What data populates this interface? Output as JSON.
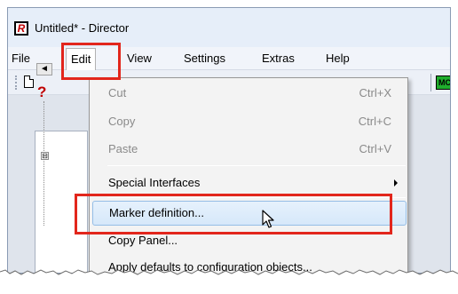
{
  "window": {
    "title": "Untitled* - Director",
    "logo_letter": "R"
  },
  "menubar": {
    "items": [
      {
        "label": "File"
      },
      {
        "label": "Edit"
      },
      {
        "label": "View"
      },
      {
        "label": "Settings"
      },
      {
        "label": "Extras"
      },
      {
        "label": "Help"
      }
    ]
  },
  "toolbar": {
    "mc_label": "MC"
  },
  "edit_menu": {
    "items": [
      {
        "label": "Cut",
        "shortcut": "Ctrl+X",
        "disabled": true
      },
      {
        "label": "Copy",
        "shortcut": "Ctrl+C",
        "disabled": true
      },
      {
        "label": "Paste",
        "shortcut": "Ctrl+V",
        "disabled": true
      },
      {
        "label": "Special Interfaces",
        "has_submenu": true
      },
      {
        "label": "Marker definition...",
        "highlighted": true
      },
      {
        "label": "Copy Panel..."
      },
      {
        "label": "Apply defaults to configuration objects..."
      }
    ]
  },
  "workspace": {
    "help_glyph": "?",
    "arrow_glyph": "◄"
  },
  "colors": {
    "callout": "#e2261c",
    "hover_fill": "#d6e8fa",
    "hover_border": "#94bde6",
    "disabled_text": "#8a8a8a",
    "mc_badge": "#1fae2d"
  }
}
